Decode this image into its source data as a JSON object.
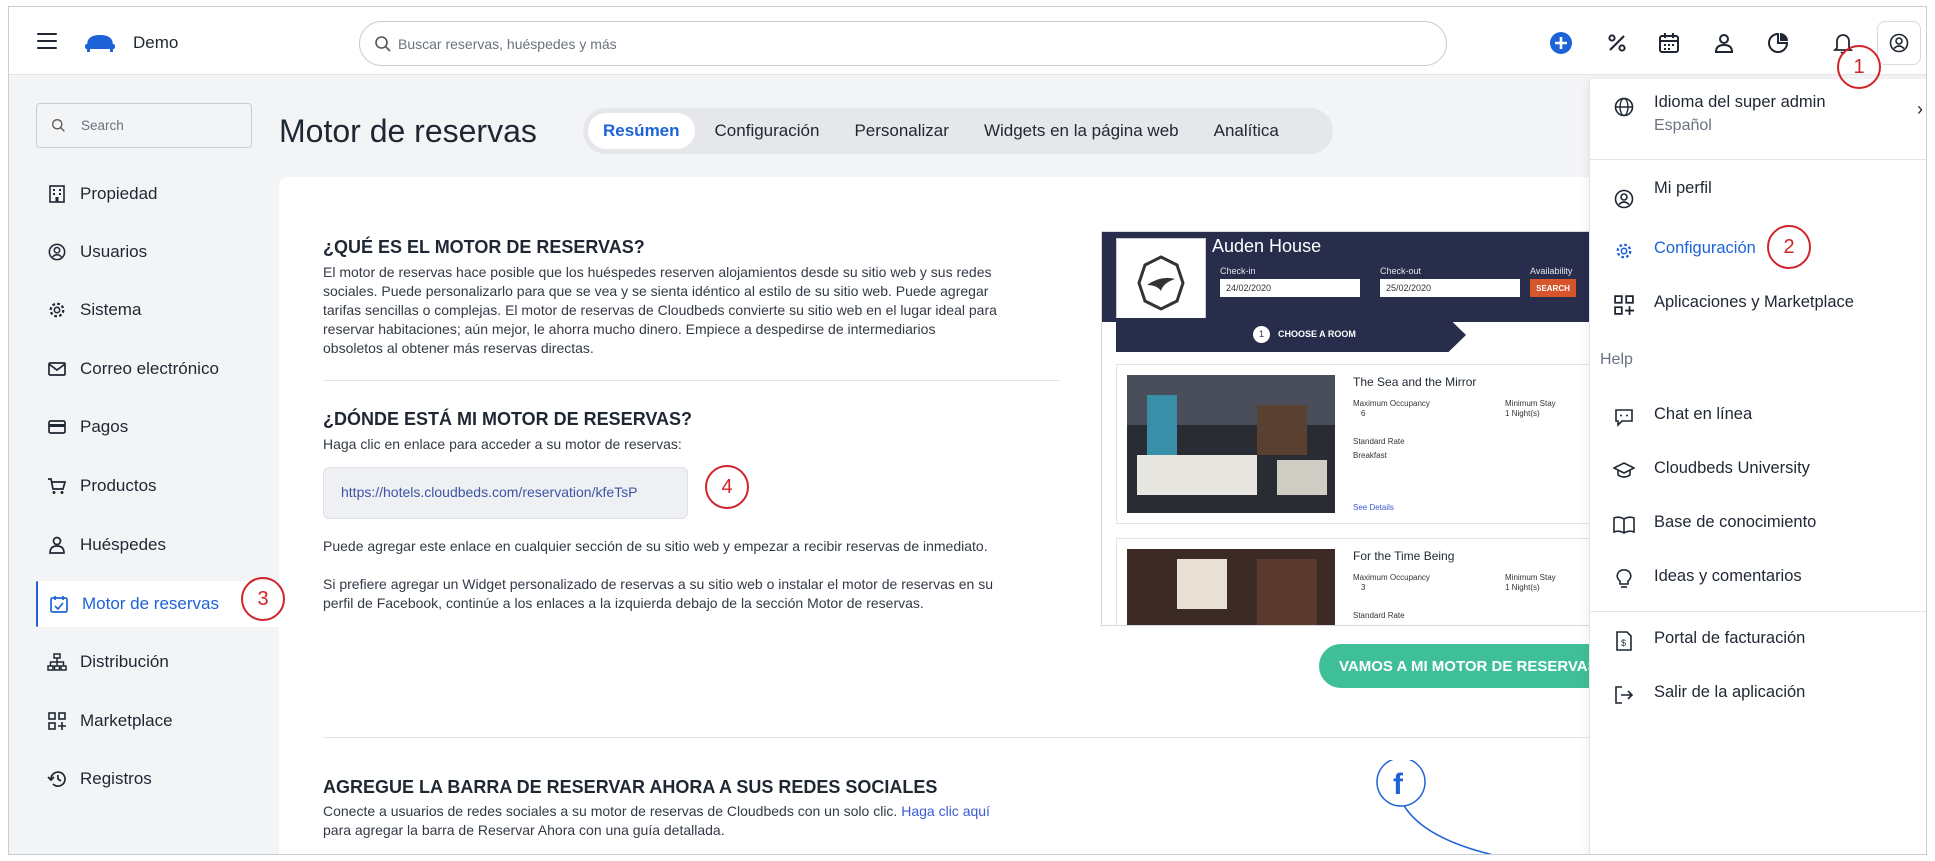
{
  "topbar": {
    "brand": "Demo",
    "search_placeholder": "Buscar reservas, huéspedes y más",
    "icons": [
      "plus-circle-icon",
      "percent-icon",
      "calendar-icon",
      "user-icon",
      "chart-pie-icon",
      "bell-icon",
      "account-icon"
    ]
  },
  "sidebar": {
    "search_placeholder": "Search",
    "items": [
      {
        "label": "Propiedad",
        "icon": "building-icon"
      },
      {
        "label": "Usuarios",
        "icon": "user-circle-icon"
      },
      {
        "label": "Sistema",
        "icon": "gear-icon"
      },
      {
        "label": "Correo electrónico",
        "icon": "mail-icon"
      },
      {
        "label": "Pagos",
        "icon": "credit-card-icon"
      },
      {
        "label": "Productos",
        "icon": "cart-icon"
      },
      {
        "label": "Huéspedes",
        "icon": "person-icon"
      },
      {
        "label": "Motor de reservas",
        "icon": "calendar-check-icon"
      },
      {
        "label": "Distribución",
        "icon": "sitemap-icon"
      },
      {
        "label": "Marketplace",
        "icon": "apps-add-icon"
      },
      {
        "label": "Registros",
        "icon": "history-icon"
      }
    ],
    "active_index": 7
  },
  "page": {
    "title": "Motor de reservas",
    "tabs": [
      "Resúmen",
      "Configuración",
      "Personalizar",
      "Widgets en la página web",
      "Analítica"
    ],
    "active_tab": 0
  },
  "content": {
    "s1_title": "¿QUÉ ES EL MOTOR DE RESERVAS?",
    "s1_body_l1": "El motor de reservas hace posible que los huéspedes reserven alojamientos desde su sitio web y sus redes",
    "s1_body_l2": "sociales. Puede personalizarlo para que se vea y se sienta idéntico al estilo de su sitio web. Puede agregar",
    "s1_body_l3": "tarifas sencillas o complejas. El motor de reservas de Cloudbeds convierte su sitio web en el lugar ideal para",
    "s1_body_l4": "reservar habitaciones; aún mejor, le ahorra mucho dinero. Empiece a despedirse de intermediarios",
    "s1_body_l5": "obsoletos al obtener más reservas directas.",
    "s2_title": "¿DÓNDE ESTÁ MI MOTOR DE RESERVAS?",
    "s2_sub": "Haga clic en enlace para acceder a su motor de reservas:",
    "url": "https://hotels.cloudbeds.com/reservation/kfeTsP",
    "s2_p1": "Puede agregar este enlace en cualquier sección de su sitio web y empezar a recibir reservas de inmediato.",
    "s2_p2_l1": "Si prefiere agregar un Widget personalizado de reservas a su sitio web o instalar el motor de reservas en su",
    "s2_p2_l2": "perfil de Facebook, continúe a los enlaces a la izquierda debajo de la sección Motor de reservas.",
    "cta": "VAMOS A MI MOTOR DE RESERVAS",
    "s3_title": "AGREGUE LA BARRA DE RESERVAR AHORA A SUS REDES SOCIALES",
    "s3_l1": "Conecte a usuarios de redes sociales a su motor de reservas de Cloudbeds con un solo clic.",
    "s3_link": "Haga clic aquí",
    "s3_l2": "para agregar la barra de Reservar Ahora con una guía detallada."
  },
  "preview": {
    "hotel": "Auden House",
    "checkin_label": "Check-in",
    "checkout_label": "Check-out",
    "availability_label": "Availability",
    "checkin": "24/02/2020",
    "checkout": "25/02/2020",
    "search": "SEARCH",
    "step_num": "1",
    "step": "CHOOSE A ROOM",
    "room1": "The Sea and the Mirror",
    "room2": "For the Time Being",
    "max_occ": "Maximum Occupancy",
    "min_stay": "Minimum Stay",
    "occ1": "6",
    "occ2": "3",
    "nights": "1 Night(s)",
    "rate_std": "Standard Rate",
    "rate_bf": "Breakfast",
    "details": "See Details"
  },
  "dropdown": {
    "language_label": "Idioma del super admin",
    "language_value": "Español",
    "profile": "Mi perfil",
    "config": "Configuración",
    "apps": "Aplicaciones y Marketplace",
    "help": "Help",
    "chat": "Chat en línea",
    "university": "Cloudbeds University",
    "kb": "Base de conocimiento",
    "ideas": "Ideas y comentarios",
    "billing": "Portal de facturación",
    "logout": "Salir de la aplicación"
  },
  "callouts": [
    "1",
    "2",
    "3",
    "4"
  ],
  "colors": {
    "accent": "#1d63d8",
    "cta": "#3fbf98",
    "callout": "#d0242b"
  }
}
